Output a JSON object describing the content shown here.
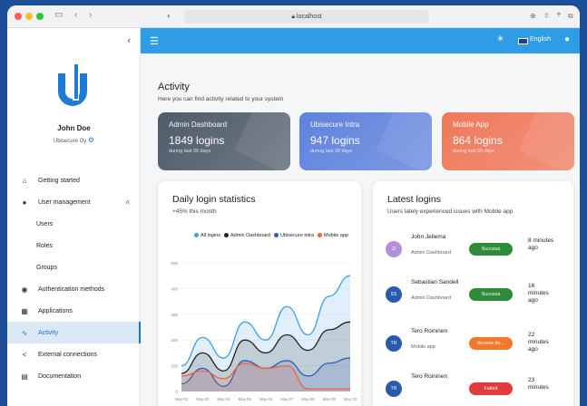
{
  "browser": {
    "url": "localhost"
  },
  "sidebar": {
    "user": {
      "name": "John Doe",
      "org": "Ubisecure Oy"
    },
    "items": [
      {
        "label": "Getting started",
        "icon": "home-icon",
        "glyph": "⌂",
        "type": "item"
      },
      {
        "label": "User management",
        "icon": "person-icon",
        "glyph": "●",
        "type": "group"
      },
      {
        "label": "Users",
        "type": "sub"
      },
      {
        "label": "Roles",
        "type": "sub"
      },
      {
        "label": "Groups",
        "type": "sub"
      },
      {
        "label": "Authentication methods",
        "icon": "fingerprint-icon",
        "glyph": "◉",
        "type": "item"
      },
      {
        "label": "Applications",
        "icon": "grid-icon",
        "glyph": "▦",
        "type": "item"
      },
      {
        "label": "Activity",
        "icon": "activity-icon",
        "glyph": "∿",
        "type": "active"
      },
      {
        "label": "External connections",
        "icon": "share-icon",
        "glyph": "<",
        "type": "item"
      },
      {
        "label": "Documentation",
        "icon": "book-icon",
        "glyph": "▤",
        "type": "item"
      }
    ]
  },
  "topbar": {
    "language": "English"
  },
  "activity": {
    "title": "Activity",
    "subtitle": "Here you can find activity related to your system"
  },
  "cards": [
    {
      "title": "Admin Dashboard",
      "value": "1849 logins",
      "sub": "during last 30 days",
      "color": "#4f5b69"
    },
    {
      "title": "Ubisecure Intra",
      "value": "947 logins",
      "sub": "during last 30 days",
      "color": "#5f82dc"
    },
    {
      "title": "Mobile App",
      "value": "864 logins",
      "sub": "during last 30 days",
      "color": "#f0795b"
    }
  ],
  "daily": {
    "title": "Daily login statistics",
    "subtitle": "+45% this month"
  },
  "chart_data": {
    "type": "area",
    "ylim": [
      0,
      500
    ],
    "yticks": [
      "500",
      "400",
      "300",
      "200",
      "100",
      "0"
    ],
    "x": [
      "May-02",
      "May-03",
      "May-04",
      "May-05",
      "May-06",
      "May-07",
      "May-08",
      "May-09",
      "May-10"
    ],
    "series": [
      {
        "name": "All logins",
        "color": "#3f9ee8",
        "values": [
          100,
          210,
          130,
          270,
          200,
          330,
          220,
          370,
          450
        ]
      },
      {
        "name": "Admin Dashboard",
        "color": "#222222",
        "values": [
          70,
          150,
          80,
          200,
          150,
          220,
          160,
          240,
          270
        ]
      },
      {
        "name": "Ubisecure intra",
        "color": "#2d5db8",
        "values": [
          30,
          90,
          20,
          120,
          90,
          120,
          60,
          110,
          130
        ]
      },
      {
        "name": "Mobile app",
        "color": "#f0613a",
        "values": [
          60,
          80,
          50,
          110,
          90,
          100,
          10,
          10,
          10
        ]
      }
    ]
  },
  "latest": {
    "title": "Latest logins",
    "subtitle": "Users lately experienced issues with Mobile app",
    "rows": [
      {
        "initials": "JJ",
        "avatar_color": "#b58fd8",
        "name": "John Jellema",
        "app": "Admin Dashboard",
        "status": "Success",
        "status_color": "#2e8b3a",
        "time": "8 minutes ago"
      },
      {
        "initials": "SS",
        "avatar_color": "#2a5ab0",
        "name": "Sebastian Sandell",
        "app": "Admin Dashboard",
        "status": "Success",
        "status_color": "#2e8b3a",
        "time": "16 minutes ago"
      },
      {
        "initials": "TR",
        "avatar_color": "#2a5ab0",
        "name": "Tero Roininen",
        "app": "Mobile app",
        "status": "Access de...",
        "status_color": "#f07a2a",
        "time": "22 minutes ago"
      },
      {
        "initials": "TR",
        "avatar_color": "#2a5ab0",
        "name": "Tero Roininen",
        "app": "",
        "status": "Failed",
        "status_color": "#e23b3b",
        "time": "23 minutes"
      }
    ]
  }
}
